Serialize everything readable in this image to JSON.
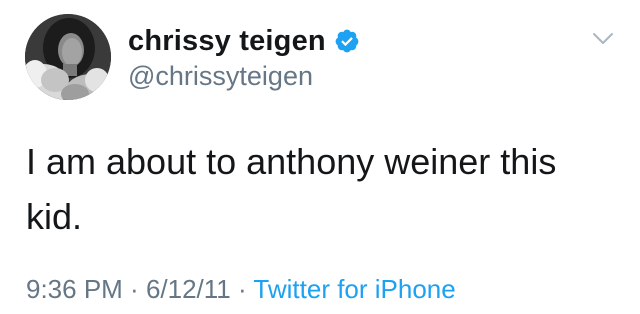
{
  "author": {
    "display_name": "chrissy teigen",
    "handle": "@chrissyteigen",
    "verified": true,
    "verified_icon": "verified-badge-icon",
    "avatar_icon": "profile-photo"
  },
  "tweet": {
    "text": "I am about to anthony weiner this kid."
  },
  "meta": {
    "time": "9:36 PM",
    "separator1": " · ",
    "date": "6/12/11",
    "separator2": " · ",
    "source": "Twitter for iPhone"
  },
  "menu": {
    "icon": "chevron-down-icon"
  },
  "colors": {
    "text": "#14171a",
    "secondary": "#657786",
    "link": "#1da1f2",
    "verified": "#1da1f2"
  }
}
